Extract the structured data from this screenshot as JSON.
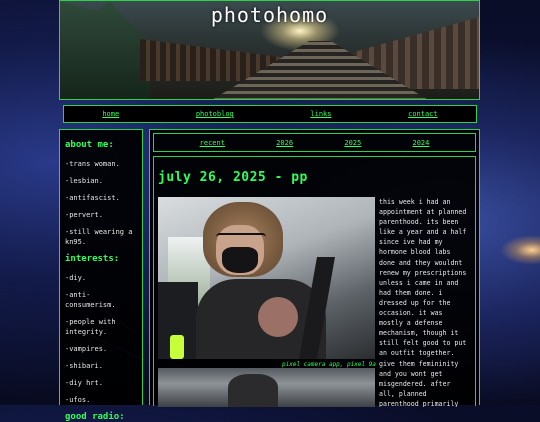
{
  "site": {
    "title": "photohomo"
  },
  "nav": {
    "links": [
      "home",
      "photoblog",
      "links",
      "contact"
    ]
  },
  "sidebar": {
    "about_heading": "about me:",
    "about_items": [
      "-trans woman.",
      "-lesbian.",
      "-antifascist.",
      "-pervert.",
      "-still wearing a\nkn95."
    ],
    "interests_heading": "interests:",
    "interests_items": [
      "-diy.",
      "-anti-\nconsumerism.",
      "-people with\nintegrity.",
      "-vampires.",
      "-shibari.",
      "-diy hrt.",
      "-ufos."
    ],
    "radio_heading": "good radio:"
  },
  "years": {
    "links": [
      "recent",
      "2026",
      "2025",
      "2024"
    ]
  },
  "post": {
    "title": "july 26, 2025 - pp",
    "caption": "pixel camera app, pixel 9a",
    "text": "this week i had an\nappointment at planned\nparenthood. its been\nlike a year and a half\nsince ive had my\nhormone blood labs\ndone and they wouldnt\nrenew my prescriptions\nunless i came in and\nhad them done. i\ndressed up for the\noccasion. it was\nmostly a defense\nmechanism, though it\nstill felt good to put\nan outfit together.\ngive them femininity\nand you wont get\nmisgendered. after\nall, planned\nparenthood primarily\nserves cis straight\nwomen and i have been\nmisgendered at trans"
  },
  "colors": {
    "accent_green": "#2dff5a",
    "border_green": "#2bd24a",
    "panel_bg": "#000000",
    "text": "#e8e8e8"
  }
}
